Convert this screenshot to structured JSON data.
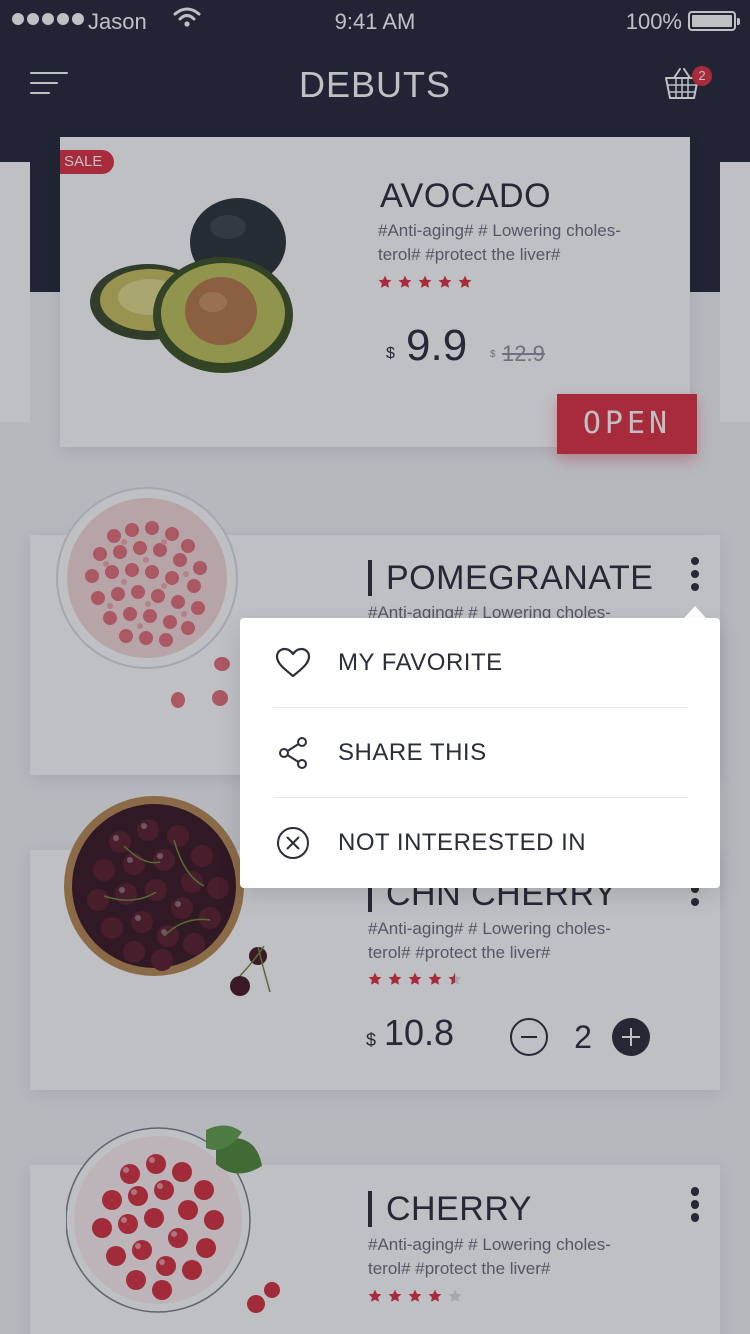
{
  "status_bar": {
    "carrier": "Jason",
    "time": "9:41 AM",
    "battery": "100%"
  },
  "header": {
    "title": "DEBUTS",
    "cart_count": "2"
  },
  "colors": {
    "header_bg": "#232838",
    "accent_red": "#e03142",
    "text_dark": "#2b2e3a"
  },
  "products": [
    {
      "name": "AVOCADO",
      "tags_line1": "#Anti-aging#   # Lowering choles-",
      "tags_line2": "terol#   #protect the liver#",
      "rating": 5,
      "currency": "$",
      "price": "9.9",
      "old_currency": "$",
      "old_price": "12.9",
      "badge": "SALE",
      "action": "OPEN"
    },
    {
      "name": "POMEGRANATE",
      "tags_line1": "#Anti-aging#   # Lowering choles-"
    },
    {
      "name": "CHN CHERRY",
      "tags_line1": "#Anti-aging#   # Lowering choles-",
      "tags_line2": "terol#   #protect the liver#",
      "rating": 4.5,
      "currency": "$",
      "price": "10.8",
      "quantity": "2"
    },
    {
      "name": "CHERRY",
      "tags_line1": "#Anti-aging#   # Lowering choles-",
      "tags_line2": "terol#   #protect the liver#",
      "rating": 4
    }
  ],
  "popup_menu": {
    "items": [
      {
        "label": "MY FAVORITE",
        "icon": "heart-icon"
      },
      {
        "label": "SHARE THIS",
        "icon": "share-icon"
      },
      {
        "label": "NOT INTERESTED IN",
        "icon": "close-circle-icon"
      }
    ]
  }
}
